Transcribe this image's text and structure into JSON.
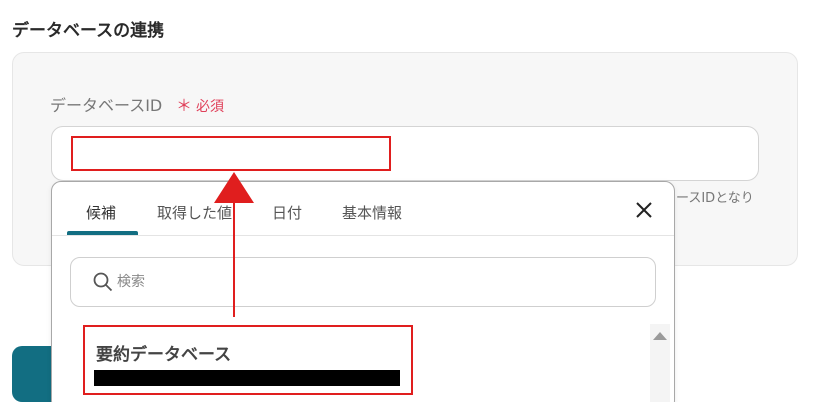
{
  "section": {
    "title": "データベースの連携"
  },
  "field": {
    "label": "データベースID",
    "required_mark": "＊",
    "required_text": "必須",
    "value": "",
    "hint": "ースIDとなり"
  },
  "dropdown": {
    "tabs": [
      {
        "label": "候補",
        "active": true
      },
      {
        "label": "取得した値",
        "active": false
      },
      {
        "label": "日付",
        "active": false
      },
      {
        "label": "基本情報",
        "active": false
      }
    ],
    "search": {
      "placeholder": "検索",
      "value": ""
    },
    "options": [
      {
        "title": "要約データベース"
      }
    ]
  },
  "colors": {
    "accent": "#126e82",
    "required": "#e0405a",
    "annotation": "#e01e1e"
  },
  "icons": {
    "close": "close-icon",
    "search": "search-icon",
    "scroll_up": "scroll-up-arrow-icon"
  }
}
